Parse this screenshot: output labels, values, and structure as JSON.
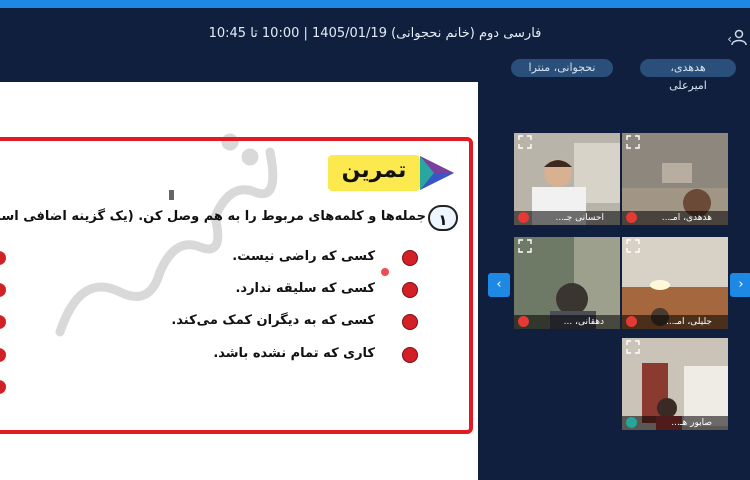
{
  "header": {
    "class_title": "فارسی دوم (خانم نحجوانی) 1405/01/19 | 10:00 تا 10:45",
    "chips": [
      {
        "label": "هدهدی، امیرعلی"
      },
      {
        "label": "نحجوانی، منترا"
      }
    ]
  },
  "slide": {
    "watermark": "گزینه",
    "exercise_title": "تمرین",
    "question_number": "۱",
    "instruction": "جمله‌ها و کلمه‌های مربوط را به هم وصل کن. (یک گزینه اضافی است.)",
    "items": [
      {
        "text": "کسی که راضی نیست."
      },
      {
        "text": "کسی که سلیقه ندارد."
      },
      {
        "text": "کسی که به دیگران کمک می‌کند."
      },
      {
        "text": "کاری که تمام نشده باشد."
      }
    ]
  },
  "participants": [
    {
      "name": "احسانی جـ..."
    },
    {
      "name": "هدهدی، امـ..."
    },
    {
      "name": "دهقانی، ..."
    },
    {
      "name": "جلیلی، امـ..."
    },
    {
      "name": "صابور هـ..."
    }
  ],
  "colors": {
    "background": "#0f1f3d",
    "accent": "#1e88e5",
    "frame_red": "#e21b23",
    "title_yellow": "#fce94d"
  },
  "icons": {
    "user": "user-icon",
    "nav_prev": "chevron-left-icon",
    "nav_next": "chevron-right-icon",
    "expand": "expand-icon",
    "mic_muted": "mic-muted-icon",
    "mic_on": "mic-icon",
    "play": "play-triangle-icon"
  }
}
